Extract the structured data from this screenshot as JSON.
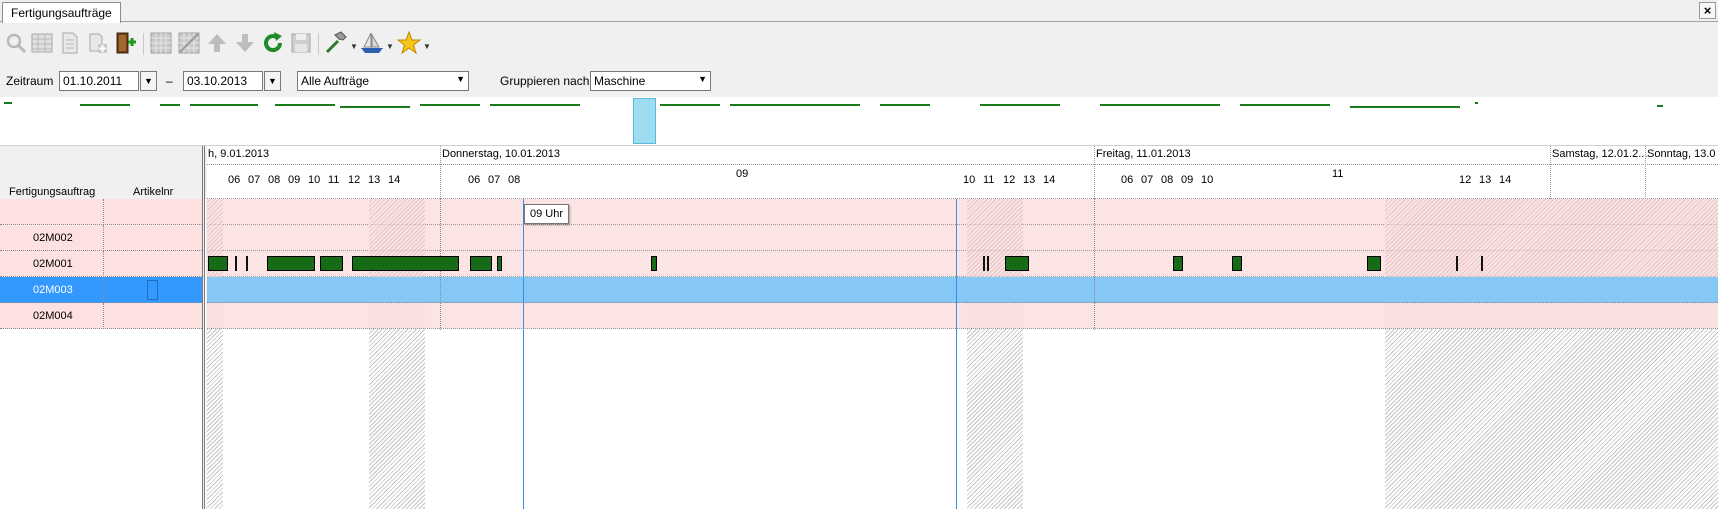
{
  "tab": {
    "title": "Fertigungsaufträge",
    "close": "×"
  },
  "toolbar": {
    "icons": [
      "search-icon",
      "table-icon",
      "document-icon",
      "new-document-icon",
      "exit-door-icon",
      "grid-icon",
      "grid-disabled-icon",
      "arrow-up-icon",
      "arrow-down-icon",
      "refresh-icon",
      "save-icon",
      "hammer-icon",
      "ship-icon",
      "star-icon"
    ]
  },
  "filter": {
    "zeitraum_label": "Zeitraum",
    "date_from": "01.10.2011",
    "dash": "–",
    "date_to": "03.10.2013",
    "auftraege": "Alle Aufträge",
    "gruppieren_label": "Gruppieren nach",
    "gruppieren_value": "Maschine"
  },
  "grid": {
    "columns": [
      "Fertigungsauftrag",
      "Artikelnr"
    ],
    "rows": [
      {
        "auftrag": ""
      },
      {
        "auftrag": "02M002"
      },
      {
        "auftrag": "02M001"
      },
      {
        "auftrag": "02M003"
      },
      {
        "auftrag": "02M004"
      }
    ],
    "selected_row": 3
  },
  "gantt": {
    "days": [
      "h, 9.01.2013",
      "Donnerstag, 10.01.2013",
      "Freitag, 11.01.2013",
      "Samstag, 12.01.2...",
      "Sonntag, 13.0"
    ],
    "hours_day1": [
      "06",
      "07",
      "08",
      "09",
      "10",
      "11",
      "12",
      "13",
      "14"
    ],
    "hours_day2a": [
      "06",
      "07",
      "08"
    ],
    "hour_big_day2": "09",
    "hours_day2b": [
      "10",
      "11",
      "12",
      "13",
      "14"
    ],
    "hours_day3a": [
      "06",
      "07",
      "08",
      "09",
      "10"
    ],
    "hour_big_day3": "11",
    "hours_day3b": [
      "12",
      "13",
      "14"
    ],
    "tooltip": "09 Uhr"
  },
  "colors": {
    "bar": "#176b17",
    "row_bg": "#fde0e0",
    "selected": "#3399ff",
    "selected_light": "#86c8f5"
  }
}
